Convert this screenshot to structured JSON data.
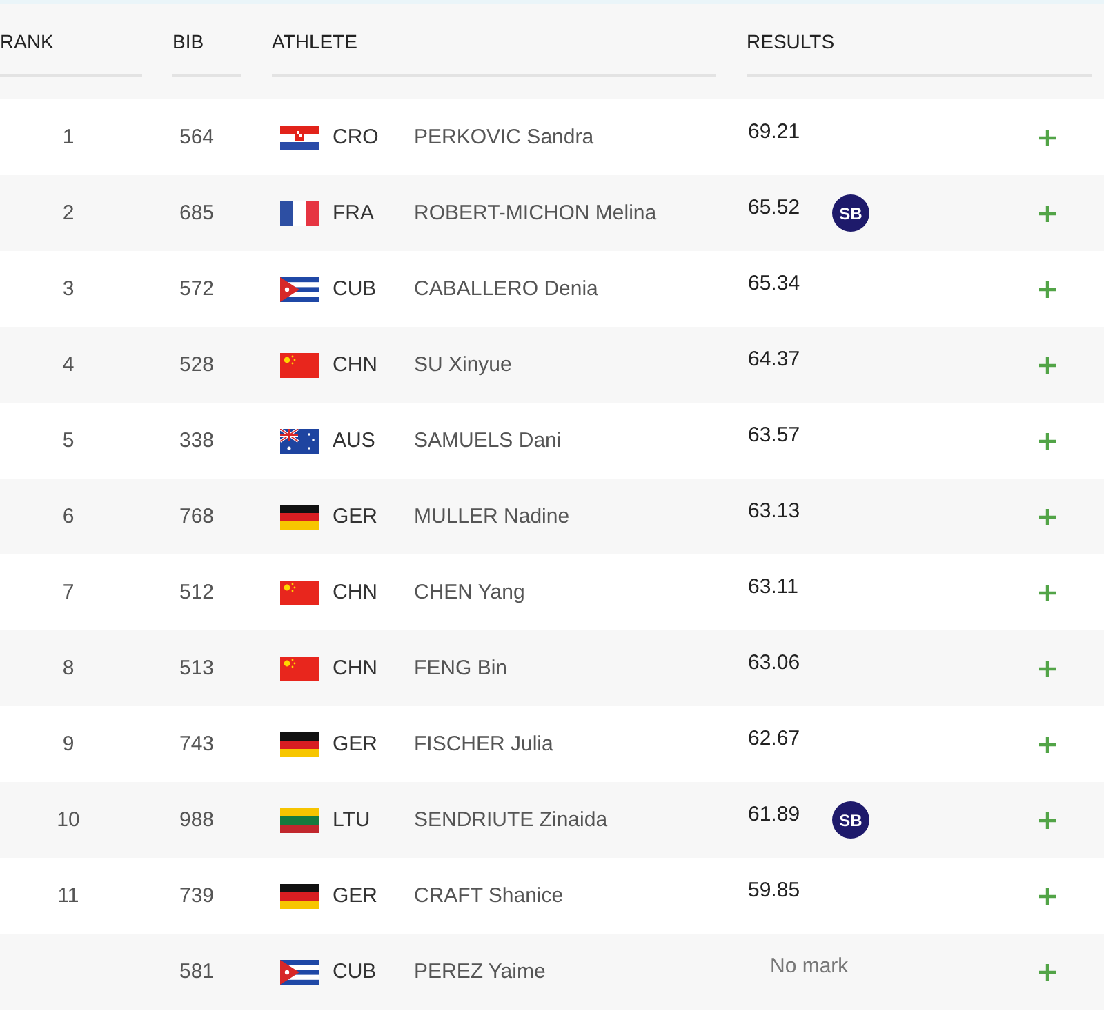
{
  "table": {
    "columns": [
      "RANK",
      "BIB",
      "ATHLETE",
      "RESULTS"
    ],
    "rows": [
      {
        "rank": "1",
        "bib": "564",
        "flag": {
          "kind": "hr"
        },
        "country": "CRO",
        "athlete": "PERKOVIC Sandra",
        "result": "69.21",
        "kind": "mark"
      },
      {
        "rank": "2",
        "bib": "685",
        "flag": {
          "kind": "fr"
        },
        "country": "FRA",
        "athlete": "ROBERT-MICHON Melina",
        "result": "65.52",
        "kind": "mark",
        "badge": "SB"
      },
      {
        "rank": "3",
        "bib": "572",
        "flag": {
          "kind": "cu"
        },
        "country": "CUB",
        "athlete": "CABALLERO Denia",
        "result": "65.34",
        "kind": "mark"
      },
      {
        "rank": "4",
        "bib": "528",
        "flag": {
          "kind": "cn"
        },
        "country": "CHN",
        "athlete": "SU Xinyue",
        "result": "64.37",
        "kind": "mark"
      },
      {
        "rank": "5",
        "bib": "338",
        "flag": {
          "kind": "au"
        },
        "country": "AUS",
        "athlete": "SAMUELS Dani",
        "result": "63.57",
        "kind": "mark"
      },
      {
        "rank": "6",
        "bib": "768",
        "flag": {
          "kind": "de"
        },
        "country": "GER",
        "athlete": "MULLER Nadine",
        "result": "63.13",
        "kind": "mark"
      },
      {
        "rank": "7",
        "bib": "512",
        "flag": {
          "kind": "cn"
        },
        "country": "CHN",
        "athlete": "CHEN Yang",
        "result": "63.11",
        "kind": "mark"
      },
      {
        "rank": "8",
        "bib": "513",
        "flag": {
          "kind": "cn"
        },
        "country": "CHN",
        "athlete": "FENG Bin",
        "result": "63.06",
        "kind": "mark"
      },
      {
        "rank": "9",
        "bib": "743",
        "flag": {
          "kind": "de"
        },
        "country": "GER",
        "athlete": "FISCHER Julia",
        "result": "62.67",
        "kind": "mark"
      },
      {
        "rank": "10",
        "bib": "988",
        "flag": {
          "kind": "lt"
        },
        "country": "LTU",
        "athlete": "SENDRIUTE Zinaida",
        "result": "61.89",
        "kind": "mark",
        "badge": "SB"
      },
      {
        "rank": "11",
        "bib": "739",
        "flag": {
          "kind": "de"
        },
        "country": "GER",
        "athlete": "CRAFT Shanice",
        "result": "59.85",
        "kind": "mark"
      },
      {
        "bib": "581",
        "flag": {
          "kind": "cu"
        },
        "country": "CUB",
        "athlete": "PEREZ Yaime",
        "result": "No mark",
        "kind": "no_mark"
      }
    ]
  }
}
